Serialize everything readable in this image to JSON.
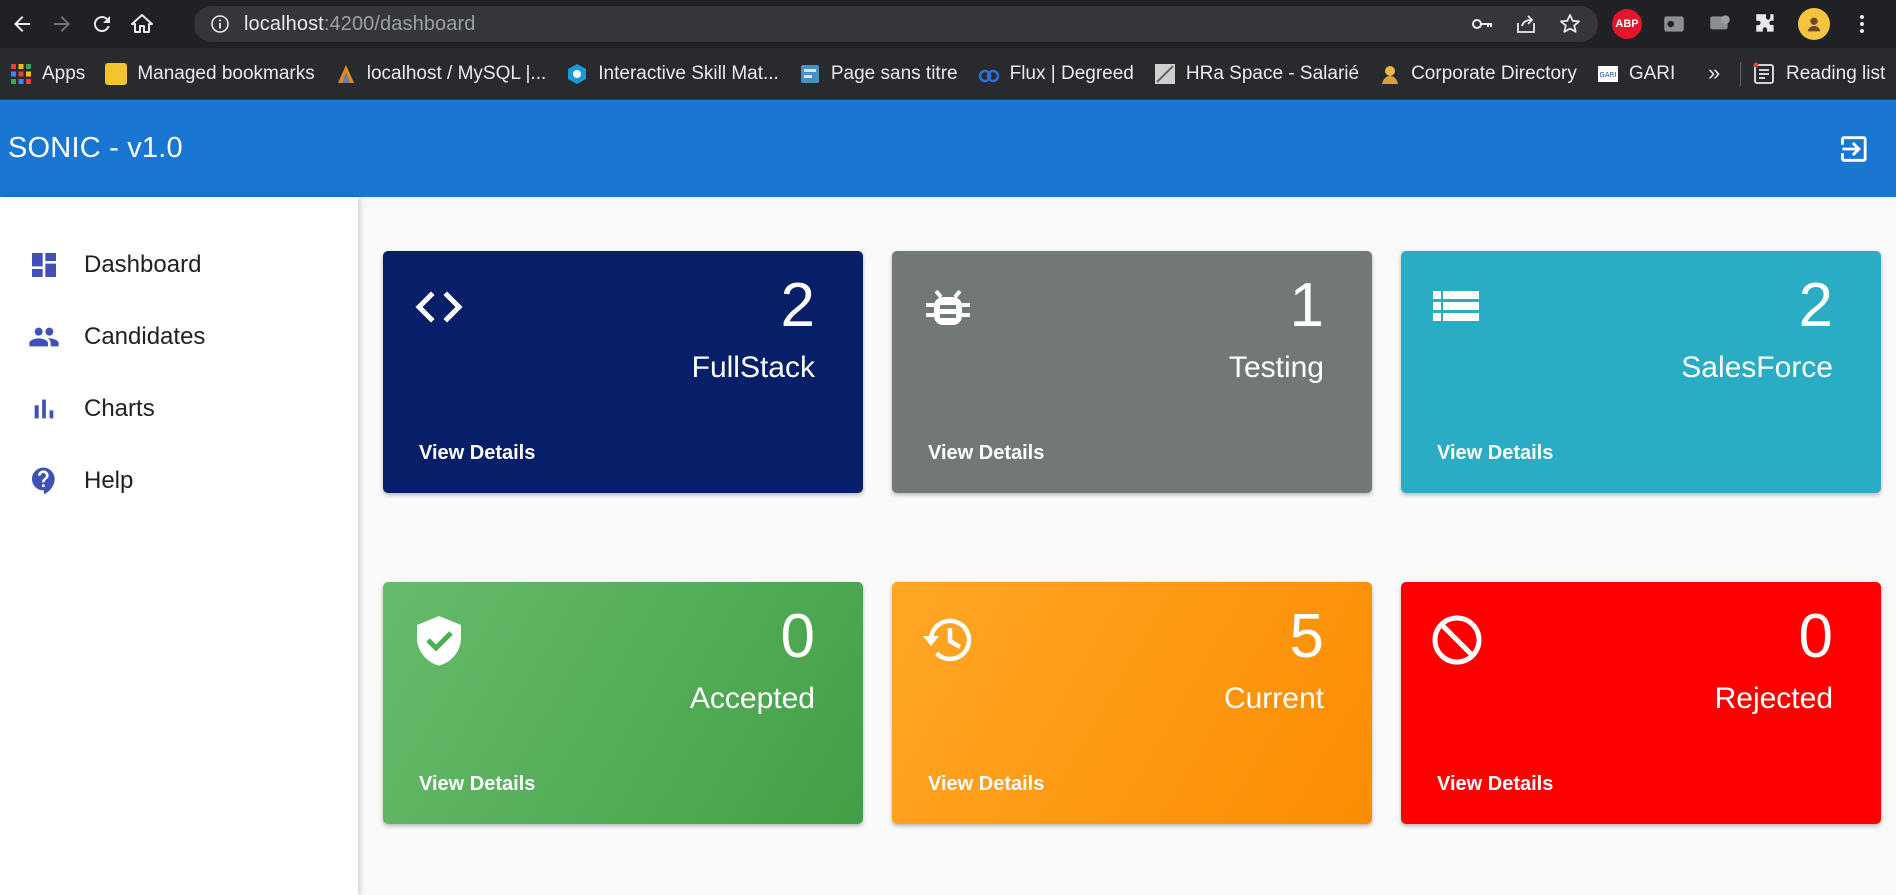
{
  "browser": {
    "url_host": "localhost",
    "url_path": ":4200/dashboard",
    "extensions": {
      "abp_label": "ABP"
    },
    "bookmarks": [
      {
        "label": "Apps",
        "icon": "apps-grid-icon",
        "color": "#e94235"
      },
      {
        "label": "Managed bookmarks",
        "icon": "folder-icon",
        "color": "#f4c430"
      },
      {
        "label": "localhost / MySQL |...",
        "icon": "phpmyadmin-icon",
        "color": "#e48b1c"
      },
      {
        "label": "Interactive Skill Mat...",
        "icon": "skill-matrix-icon",
        "color": "#1a9bd7"
      },
      {
        "label": "Page sans titre",
        "icon": "page-icon",
        "color": "#4a90c2"
      },
      {
        "label": "Flux | Degreed",
        "icon": "degreed-icon",
        "color": "#2f6fdc"
      },
      {
        "label": "HRa Space - Salarié",
        "icon": "hra-icon",
        "color": "#cccccc"
      },
      {
        "label": "Corporate Directory",
        "icon": "directory-icon",
        "color": "#e8b84a"
      },
      {
        "label": "GARI",
        "icon": "gari-icon",
        "color": "#ffffff"
      }
    ],
    "more_label": "»",
    "reading_list_label": "Reading list"
  },
  "app": {
    "title": "SONIC - v1.0",
    "toolbar_color": "#1976d2"
  },
  "sidebar": {
    "items": [
      {
        "label": "Dashboard",
        "icon": "dashboard-icon"
      },
      {
        "label": "Candidates",
        "icon": "people-icon"
      },
      {
        "label": "Charts",
        "icon": "bar-chart-icon"
      },
      {
        "label": "Help",
        "icon": "help-icon"
      }
    ],
    "icon_color": "#3f51b5"
  },
  "cards": [
    {
      "count": "2",
      "label": "FullStack",
      "details": "View Details",
      "icon": "code-icon",
      "color": "#071f68"
    },
    {
      "count": "1",
      "label": "Testing",
      "details": "View Details",
      "icon": "bug-icon",
      "color": "#727878"
    },
    {
      "count": "2",
      "label": "SalesForce",
      "details": "View Details",
      "icon": "list-icon",
      "color": "#2aacc4"
    },
    {
      "count": "0",
      "label": "Accepted",
      "details": "View Details",
      "icon": "verified-shield-icon",
      "color": "#4caf50"
    },
    {
      "count": "5",
      "label": "Current",
      "details": "View Details",
      "icon": "history-icon",
      "color": "#fb8c00"
    },
    {
      "count": "0",
      "label": "Rejected",
      "details": "View Details",
      "icon": "block-icon",
      "color": "#ff0000"
    }
  ]
}
